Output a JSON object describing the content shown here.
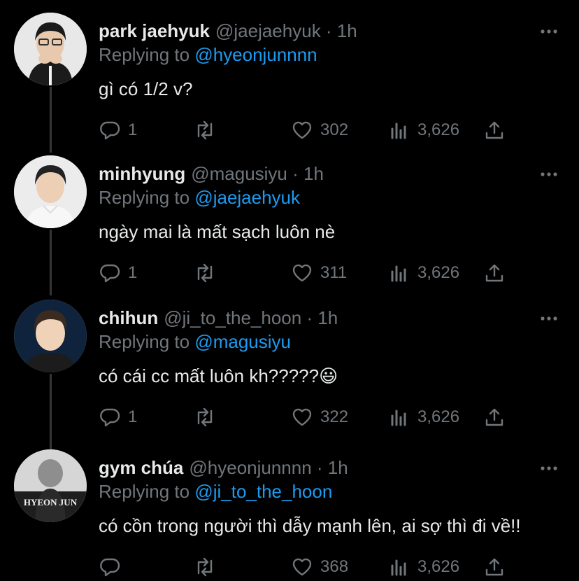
{
  "tweets": [
    {
      "name": "park jaehyuk",
      "handle": "@jaejaehyuk",
      "time": "1h",
      "replying_prefix": "Replying to ",
      "replying_to": "@hyeonjunnnn",
      "text": "gì có 1/2 v?",
      "counts": {
        "reply": "1",
        "retweet": "",
        "like": "302",
        "views": "3,626"
      }
    },
    {
      "name": "minhyung",
      "handle": "@magusiyu",
      "time": "1h",
      "replying_prefix": "Replying to ",
      "replying_to": "@jaejaehyuk",
      "text": "ngày mai là mất sạch luôn nè",
      "counts": {
        "reply": "1",
        "retweet": "",
        "like": "311",
        "views": "3,626"
      }
    },
    {
      "name": "chihun",
      "handle": "@ji_to_the_hoon",
      "time": "1h",
      "replying_prefix": "Replying to ",
      "replying_to": "@magusiyu",
      "text": "có cái cc mất luôn kh?????😃",
      "counts": {
        "reply": "1",
        "retweet": "",
        "like": "322",
        "views": "3,626"
      }
    },
    {
      "name": "gym chúa",
      "handle": "@hyeonjunnnn",
      "time": "1h",
      "replying_prefix": "Replying to ",
      "replying_to": "@ji_to_the_hoon",
      "text": "có cồn trong người thì dẫy mạnh lên, ai sợ thì đi về!!",
      "counts": {
        "reply": "",
        "retweet": "",
        "like": "368",
        "views": "3,626"
      },
      "avatar_text": "HYEON JUN"
    }
  ],
  "separator": " · ",
  "colors": {
    "background": "#000000",
    "text": "#e7e9ea",
    "muted": "#71767b",
    "link": "#1d9bf0",
    "thread": "#333639"
  },
  "icons": [
    "more-icon",
    "reply-icon",
    "retweet-icon",
    "like-icon",
    "views-icon",
    "share-icon"
  ]
}
